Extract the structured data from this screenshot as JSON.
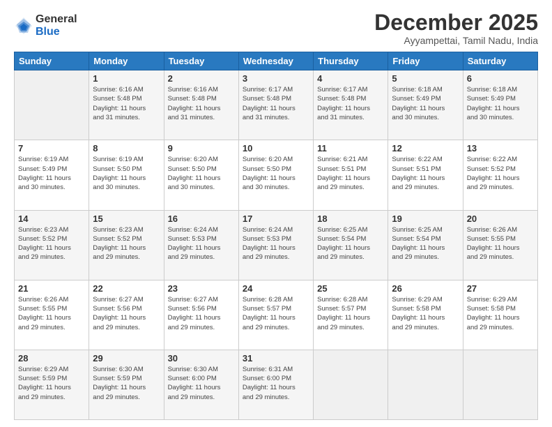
{
  "logo": {
    "general": "General",
    "blue": "Blue"
  },
  "title": "December 2025",
  "subtitle": "Ayyampettai, Tamil Nadu, India",
  "days_header": [
    "Sunday",
    "Monday",
    "Tuesday",
    "Wednesday",
    "Thursday",
    "Friday",
    "Saturday"
  ],
  "weeks": [
    [
      {
        "day": "",
        "sunrise": "",
        "sunset": "",
        "daylight": ""
      },
      {
        "day": "1",
        "sunrise": "Sunrise: 6:16 AM",
        "sunset": "Sunset: 5:48 PM",
        "daylight": "Daylight: 11 hours and 31 minutes."
      },
      {
        "day": "2",
        "sunrise": "Sunrise: 6:16 AM",
        "sunset": "Sunset: 5:48 PM",
        "daylight": "Daylight: 11 hours and 31 minutes."
      },
      {
        "day": "3",
        "sunrise": "Sunrise: 6:17 AM",
        "sunset": "Sunset: 5:48 PM",
        "daylight": "Daylight: 11 hours and 31 minutes."
      },
      {
        "day": "4",
        "sunrise": "Sunrise: 6:17 AM",
        "sunset": "Sunset: 5:48 PM",
        "daylight": "Daylight: 11 hours and 31 minutes."
      },
      {
        "day": "5",
        "sunrise": "Sunrise: 6:18 AM",
        "sunset": "Sunset: 5:49 PM",
        "daylight": "Daylight: 11 hours and 30 minutes."
      },
      {
        "day": "6",
        "sunrise": "Sunrise: 6:18 AM",
        "sunset": "Sunset: 5:49 PM",
        "daylight": "Daylight: 11 hours and 30 minutes."
      }
    ],
    [
      {
        "day": "7",
        "sunrise": "Sunrise: 6:19 AM",
        "sunset": "Sunset: 5:49 PM",
        "daylight": "Daylight: 11 hours and 30 minutes."
      },
      {
        "day": "8",
        "sunrise": "Sunrise: 6:19 AM",
        "sunset": "Sunset: 5:50 PM",
        "daylight": "Daylight: 11 hours and 30 minutes."
      },
      {
        "day": "9",
        "sunrise": "Sunrise: 6:20 AM",
        "sunset": "Sunset: 5:50 PM",
        "daylight": "Daylight: 11 hours and 30 minutes."
      },
      {
        "day": "10",
        "sunrise": "Sunrise: 6:20 AM",
        "sunset": "Sunset: 5:50 PM",
        "daylight": "Daylight: 11 hours and 30 minutes."
      },
      {
        "day": "11",
        "sunrise": "Sunrise: 6:21 AM",
        "sunset": "Sunset: 5:51 PM",
        "daylight": "Daylight: 11 hours and 29 minutes."
      },
      {
        "day": "12",
        "sunrise": "Sunrise: 6:22 AM",
        "sunset": "Sunset: 5:51 PM",
        "daylight": "Daylight: 11 hours and 29 minutes."
      },
      {
        "day": "13",
        "sunrise": "Sunrise: 6:22 AM",
        "sunset": "Sunset: 5:52 PM",
        "daylight": "Daylight: 11 hours and 29 minutes."
      }
    ],
    [
      {
        "day": "14",
        "sunrise": "Sunrise: 6:23 AM",
        "sunset": "Sunset: 5:52 PM",
        "daylight": "Daylight: 11 hours and 29 minutes."
      },
      {
        "day": "15",
        "sunrise": "Sunrise: 6:23 AM",
        "sunset": "Sunset: 5:52 PM",
        "daylight": "Daylight: 11 hours and 29 minutes."
      },
      {
        "day": "16",
        "sunrise": "Sunrise: 6:24 AM",
        "sunset": "Sunset: 5:53 PM",
        "daylight": "Daylight: 11 hours and 29 minutes."
      },
      {
        "day": "17",
        "sunrise": "Sunrise: 6:24 AM",
        "sunset": "Sunset: 5:53 PM",
        "daylight": "Daylight: 11 hours and 29 minutes."
      },
      {
        "day": "18",
        "sunrise": "Sunrise: 6:25 AM",
        "sunset": "Sunset: 5:54 PM",
        "daylight": "Daylight: 11 hours and 29 minutes."
      },
      {
        "day": "19",
        "sunrise": "Sunrise: 6:25 AM",
        "sunset": "Sunset: 5:54 PM",
        "daylight": "Daylight: 11 hours and 29 minutes."
      },
      {
        "day": "20",
        "sunrise": "Sunrise: 6:26 AM",
        "sunset": "Sunset: 5:55 PM",
        "daylight": "Daylight: 11 hours and 29 minutes."
      }
    ],
    [
      {
        "day": "21",
        "sunrise": "Sunrise: 6:26 AM",
        "sunset": "Sunset: 5:55 PM",
        "daylight": "Daylight: 11 hours and 29 minutes."
      },
      {
        "day": "22",
        "sunrise": "Sunrise: 6:27 AM",
        "sunset": "Sunset: 5:56 PM",
        "daylight": "Daylight: 11 hours and 29 minutes."
      },
      {
        "day": "23",
        "sunrise": "Sunrise: 6:27 AM",
        "sunset": "Sunset: 5:56 PM",
        "daylight": "Daylight: 11 hours and 29 minutes."
      },
      {
        "day": "24",
        "sunrise": "Sunrise: 6:28 AM",
        "sunset": "Sunset: 5:57 PM",
        "daylight": "Daylight: 11 hours and 29 minutes."
      },
      {
        "day": "25",
        "sunrise": "Sunrise: 6:28 AM",
        "sunset": "Sunset: 5:57 PM",
        "daylight": "Daylight: 11 hours and 29 minutes."
      },
      {
        "day": "26",
        "sunrise": "Sunrise: 6:29 AM",
        "sunset": "Sunset: 5:58 PM",
        "daylight": "Daylight: 11 hours and 29 minutes."
      },
      {
        "day": "27",
        "sunrise": "Sunrise: 6:29 AM",
        "sunset": "Sunset: 5:58 PM",
        "daylight": "Daylight: 11 hours and 29 minutes."
      }
    ],
    [
      {
        "day": "28",
        "sunrise": "Sunrise: 6:29 AM",
        "sunset": "Sunset: 5:59 PM",
        "daylight": "Daylight: 11 hours and 29 minutes."
      },
      {
        "day": "29",
        "sunrise": "Sunrise: 6:30 AM",
        "sunset": "Sunset: 5:59 PM",
        "daylight": "Daylight: 11 hours and 29 minutes."
      },
      {
        "day": "30",
        "sunrise": "Sunrise: 6:30 AM",
        "sunset": "Sunset: 6:00 PM",
        "daylight": "Daylight: 11 hours and 29 minutes."
      },
      {
        "day": "31",
        "sunrise": "Sunrise: 6:31 AM",
        "sunset": "Sunset: 6:00 PM",
        "daylight": "Daylight: 11 hours and 29 minutes."
      },
      {
        "day": "",
        "sunrise": "",
        "sunset": "",
        "daylight": ""
      },
      {
        "day": "",
        "sunrise": "",
        "sunset": "",
        "daylight": ""
      },
      {
        "day": "",
        "sunrise": "",
        "sunset": "",
        "daylight": ""
      }
    ]
  ]
}
